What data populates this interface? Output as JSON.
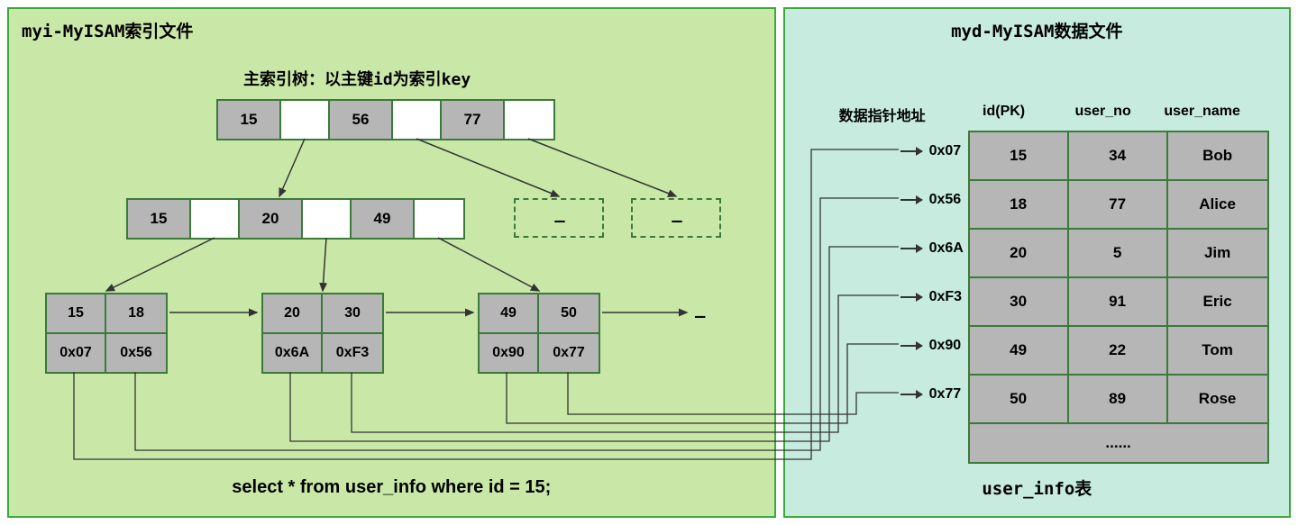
{
  "left": {
    "title": "myi-MyISAM索引文件",
    "index_subtitle": "主索引树：以主键id为索引key",
    "root": {
      "keys": [
        "15",
        "56",
        "77"
      ]
    },
    "level1_node": {
      "keys": [
        "15",
        "20",
        "49"
      ]
    },
    "leaves": [
      {
        "keys": [
          "15",
          "18"
        ],
        "ptrs": [
          "0x07",
          "0x56"
        ]
      },
      {
        "keys": [
          "20",
          "30"
        ],
        "ptrs": [
          "0x6A",
          "0xF3"
        ]
      },
      {
        "keys": [
          "49",
          "50"
        ],
        "ptrs": [
          "0x90",
          "0x77"
        ]
      }
    ],
    "sql": "select * from user_info where id = 15;",
    "dots": "......"
  },
  "right": {
    "title": "myd-MyISAM数据文件",
    "addr_header": "数据指针地址",
    "columns": [
      "id(PK)",
      "user_no",
      "user_name"
    ],
    "rows": [
      {
        "addr": "0x07",
        "id": "15",
        "user_no": "34",
        "user_name": "Bob"
      },
      {
        "addr": "0x56",
        "id": "18",
        "user_no": "77",
        "user_name": "Alice"
      },
      {
        "addr": "0x6A",
        "id": "20",
        "user_no": "5",
        "user_name": "Jim"
      },
      {
        "addr": "0xF3",
        "id": "30",
        "user_no": "91",
        "user_name": "Eric"
      },
      {
        "addr": "0x90",
        "id": "49",
        "user_no": "22",
        "user_name": "Tom"
      },
      {
        "addr": "0x77",
        "id": "50",
        "user_no": "89",
        "user_name": "Rose"
      }
    ],
    "more": "......",
    "table_caption": "user_info表"
  }
}
